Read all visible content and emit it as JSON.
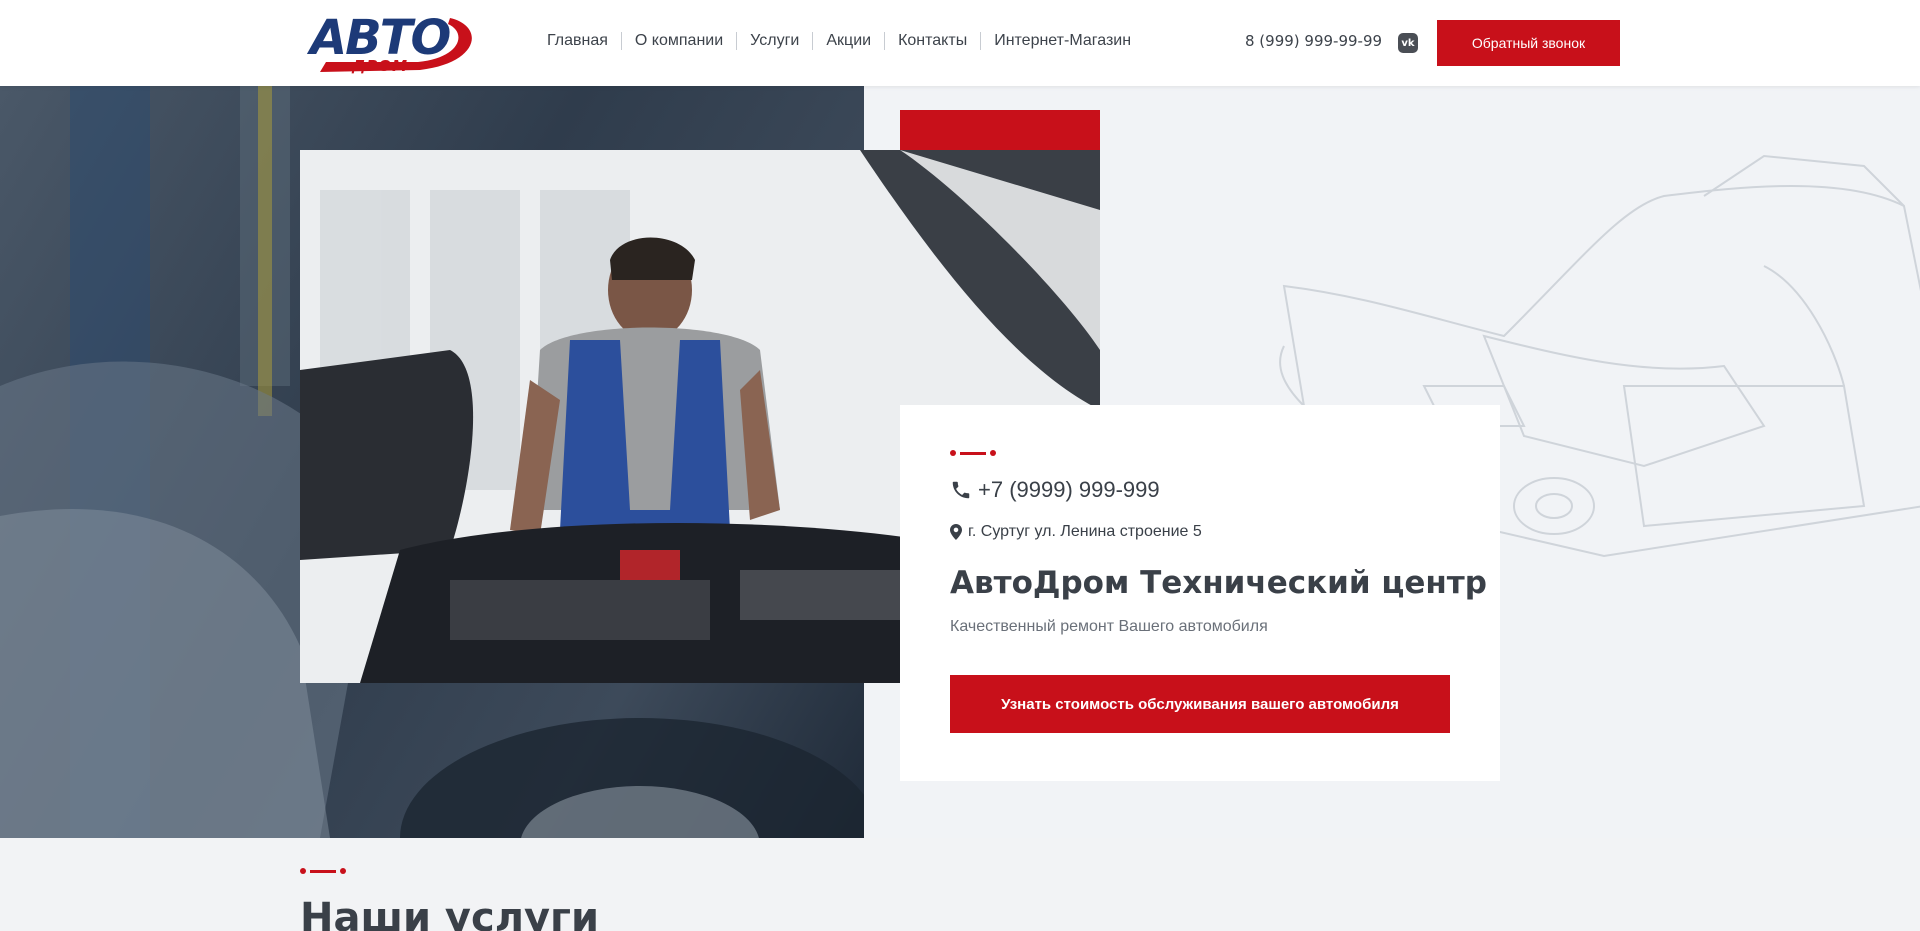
{
  "header": {
    "logo_main": "АВТО",
    "logo_sub": "ДРОМ",
    "nav": [
      "Главная",
      "О компании",
      "Услуги",
      "Акции",
      "Контакты",
      "Интернет-Магазин"
    ],
    "phone": "8 (999) 999-99-99",
    "vk_icon": "vk-icon",
    "vk_label": "vk",
    "callback_label": "Обратный звонок"
  },
  "hero": {
    "phone": "+7 (9999) 999-999",
    "address": "г. Суртуг ул. Ленина строение 5",
    "title": "АвтоДром Технический центр",
    "subtitle": "Качественный ремонт Вашего автомобиля",
    "cta_label": "Узнать стоимость обслуживания вашего автомобиля",
    "phone_icon": "phone-icon",
    "pin_icon": "map-pin-icon"
  },
  "services": {
    "title": "Наши услуги"
  },
  "colors": {
    "accent": "#c8101a",
    "brand_blue": "#1d3a78",
    "text": "#3a4048"
  }
}
